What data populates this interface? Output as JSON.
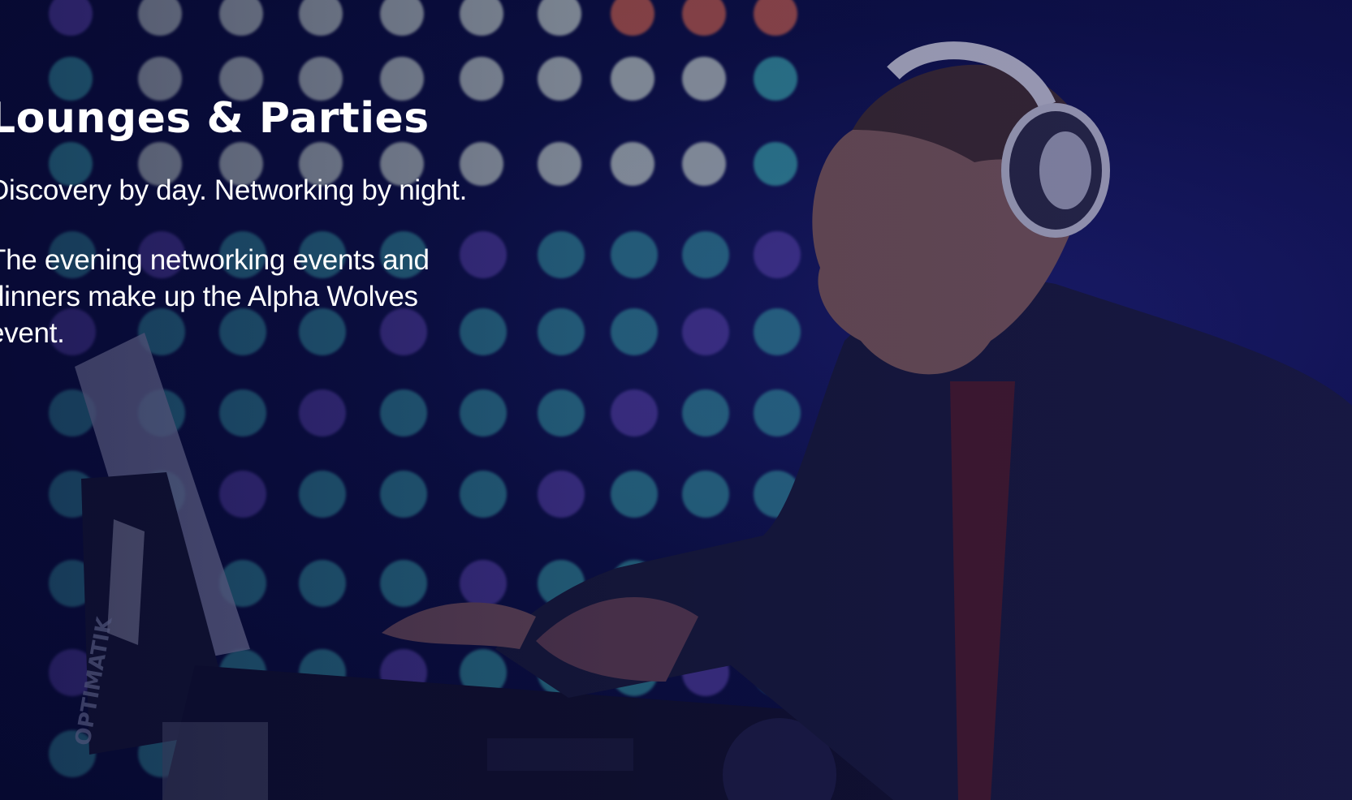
{
  "section": {
    "title": "Lounges & Parties",
    "lead": "Discovery by day. Networking by night.",
    "body": "The evening networking events and dinners make up the Alpha Wolves event."
  },
  "image": {
    "subject": "dj-with-headphones",
    "laptop_brand_text": "OPTIMATIK"
  },
  "colors": {
    "overlay": "#0a0e3a",
    "text": "#ffffff",
    "dot_teal": "#3fb6b8",
    "dot_white": "#d8e6da",
    "dot_purple": "#6b4fc2"
  }
}
